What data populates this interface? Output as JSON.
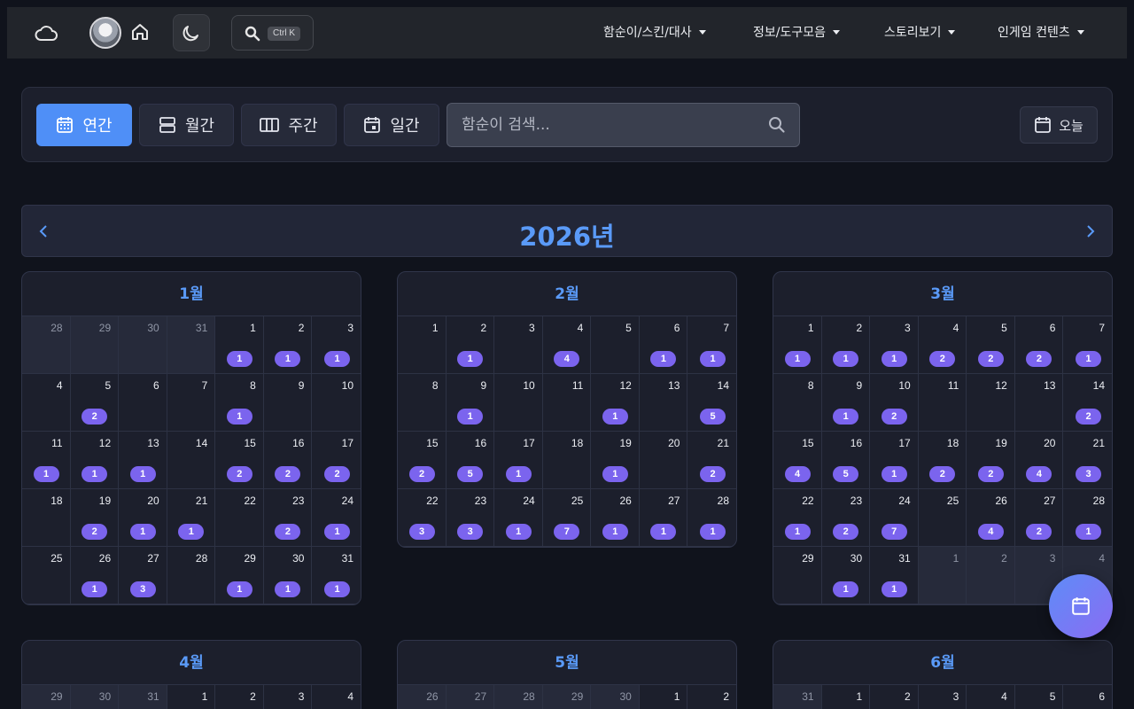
{
  "nav": {
    "icons": [
      "cloud-icon",
      "avatar",
      "home-icon",
      "moon-icon",
      "search-icon"
    ],
    "search_shortcut": "Ctrl K",
    "menus": [
      "함순이/스킨/대사",
      "정보/도구모음",
      "스토리보기",
      "인게임 컨텐츠"
    ]
  },
  "toolbar": {
    "views": [
      {
        "label": "연간",
        "icon": "calendar-grid-icon",
        "active": true
      },
      {
        "label": "월간",
        "icon": "rows-icon",
        "active": false
      },
      {
        "label": "주간",
        "icon": "columns-icon",
        "active": false
      },
      {
        "label": "일간",
        "icon": "calendar-day-icon",
        "active": false
      }
    ],
    "search_placeholder": "함순이 검색...",
    "today_label": "오늘"
  },
  "year_title": "2026년",
  "colors": {
    "accent": "#4f8ff7",
    "badge": "#7b64ee",
    "title": "#5a9af8"
  },
  "months": [
    {
      "title": "1월",
      "days": [
        [
          "28",
          "",
          true
        ],
        [
          "29",
          "",
          true
        ],
        [
          "30",
          "",
          true
        ],
        [
          "31",
          "",
          true
        ],
        [
          "1",
          "1",
          false
        ],
        [
          "2",
          "1",
          false
        ],
        [
          "3",
          "1",
          false
        ],
        [
          "4",
          "",
          false
        ],
        [
          "5",
          "2",
          false
        ],
        [
          "6",
          "",
          false
        ],
        [
          "7",
          "",
          false
        ],
        [
          "8",
          "1",
          false
        ],
        [
          "9",
          "",
          false
        ],
        [
          "10",
          "",
          false
        ],
        [
          "11",
          "1",
          false
        ],
        [
          "12",
          "1",
          false
        ],
        [
          "13",
          "1",
          false
        ],
        [
          "14",
          "",
          false
        ],
        [
          "15",
          "2",
          false
        ],
        [
          "16",
          "2",
          false
        ],
        [
          "17",
          "2",
          false
        ],
        [
          "18",
          "",
          false
        ],
        [
          "19",
          "2",
          false
        ],
        [
          "20",
          "1",
          false
        ],
        [
          "21",
          "1",
          false
        ],
        [
          "22",
          "",
          false
        ],
        [
          "23",
          "2",
          false
        ],
        [
          "24",
          "1",
          false
        ],
        [
          "25",
          "",
          false
        ],
        [
          "26",
          "1",
          false
        ],
        [
          "27",
          "3",
          false
        ],
        [
          "28",
          "",
          false
        ],
        [
          "29",
          "1",
          false
        ],
        [
          "30",
          "1",
          false
        ],
        [
          "31",
          "1",
          false
        ]
      ]
    },
    {
      "title": "2월",
      "days": [
        [
          "1",
          "",
          false
        ],
        [
          "2",
          "1",
          false
        ],
        [
          "3",
          "",
          false
        ],
        [
          "4",
          "4",
          false
        ],
        [
          "5",
          "",
          false
        ],
        [
          "6",
          "1",
          false
        ],
        [
          "7",
          "1",
          false
        ],
        [
          "8",
          "",
          false
        ],
        [
          "9",
          "1",
          false
        ],
        [
          "10",
          "",
          false
        ],
        [
          "11",
          "",
          false
        ],
        [
          "12",
          "1",
          false
        ],
        [
          "13",
          "",
          false
        ],
        [
          "14",
          "5",
          false
        ],
        [
          "15",
          "2",
          false
        ],
        [
          "16",
          "5",
          false
        ],
        [
          "17",
          "1",
          false
        ],
        [
          "18",
          "",
          false
        ],
        [
          "19",
          "1",
          false
        ],
        [
          "20",
          "",
          false
        ],
        [
          "21",
          "2",
          false
        ],
        [
          "22",
          "3",
          false
        ],
        [
          "23",
          "3",
          false
        ],
        [
          "24",
          "1",
          false
        ],
        [
          "25",
          "7",
          false
        ],
        [
          "26",
          "1",
          false
        ],
        [
          "27",
          "1",
          false
        ],
        [
          "28",
          "1",
          false
        ]
      ]
    },
    {
      "title": "3월",
      "days": [
        [
          "1",
          "1",
          false
        ],
        [
          "2",
          "1",
          false
        ],
        [
          "3",
          "1",
          false
        ],
        [
          "4",
          "2",
          false
        ],
        [
          "5",
          "2",
          false
        ],
        [
          "6",
          "2",
          false
        ],
        [
          "7",
          "1",
          false
        ],
        [
          "8",
          "",
          false
        ],
        [
          "9",
          "1",
          false
        ],
        [
          "10",
          "2",
          false
        ],
        [
          "11",
          "",
          false
        ],
        [
          "12",
          "",
          false
        ],
        [
          "13",
          "",
          false
        ],
        [
          "14",
          "2",
          false
        ],
        [
          "15",
          "4",
          false
        ],
        [
          "16",
          "5",
          false
        ],
        [
          "17",
          "1",
          false
        ],
        [
          "18",
          "2",
          false
        ],
        [
          "19",
          "2",
          false
        ],
        [
          "20",
          "4",
          false
        ],
        [
          "21",
          "3",
          false
        ],
        [
          "22",
          "1",
          false
        ],
        [
          "23",
          "2",
          false
        ],
        [
          "24",
          "7",
          false
        ],
        [
          "25",
          "",
          false
        ],
        [
          "26",
          "4",
          false
        ],
        [
          "27",
          "2",
          false
        ],
        [
          "28",
          "1",
          false
        ],
        [
          "29",
          "",
          false
        ],
        [
          "30",
          "1",
          false
        ],
        [
          "31",
          "1",
          false
        ],
        [
          "1",
          "",
          true
        ],
        [
          "2",
          "",
          true
        ],
        [
          "3",
          "",
          true
        ],
        [
          "4",
          "",
          true
        ]
      ]
    },
    {
      "title": "4월",
      "days": [
        [
          "29",
          "",
          true
        ],
        [
          "30",
          "",
          true
        ],
        [
          "31",
          "",
          true
        ],
        [
          "1",
          "",
          false
        ],
        [
          "2",
          "",
          false
        ],
        [
          "3",
          "",
          false
        ],
        [
          "4",
          "",
          false
        ]
      ]
    },
    {
      "title": "5월",
      "days": [
        [
          "26",
          "",
          true
        ],
        [
          "27",
          "",
          true
        ],
        [
          "28",
          "",
          true
        ],
        [
          "29",
          "",
          true
        ],
        [
          "30",
          "",
          true
        ],
        [
          "1",
          "",
          false
        ],
        [
          "2",
          "",
          false
        ]
      ]
    },
    {
      "title": "6월",
      "days": [
        [
          "31",
          "",
          true
        ],
        [
          "1",
          "",
          false
        ],
        [
          "2",
          "",
          false
        ],
        [
          "3",
          "",
          false
        ],
        [
          "4",
          "",
          false
        ],
        [
          "5",
          "",
          false
        ],
        [
          "6",
          "",
          false
        ]
      ]
    }
  ],
  "fab_icon": "calendar-icon"
}
